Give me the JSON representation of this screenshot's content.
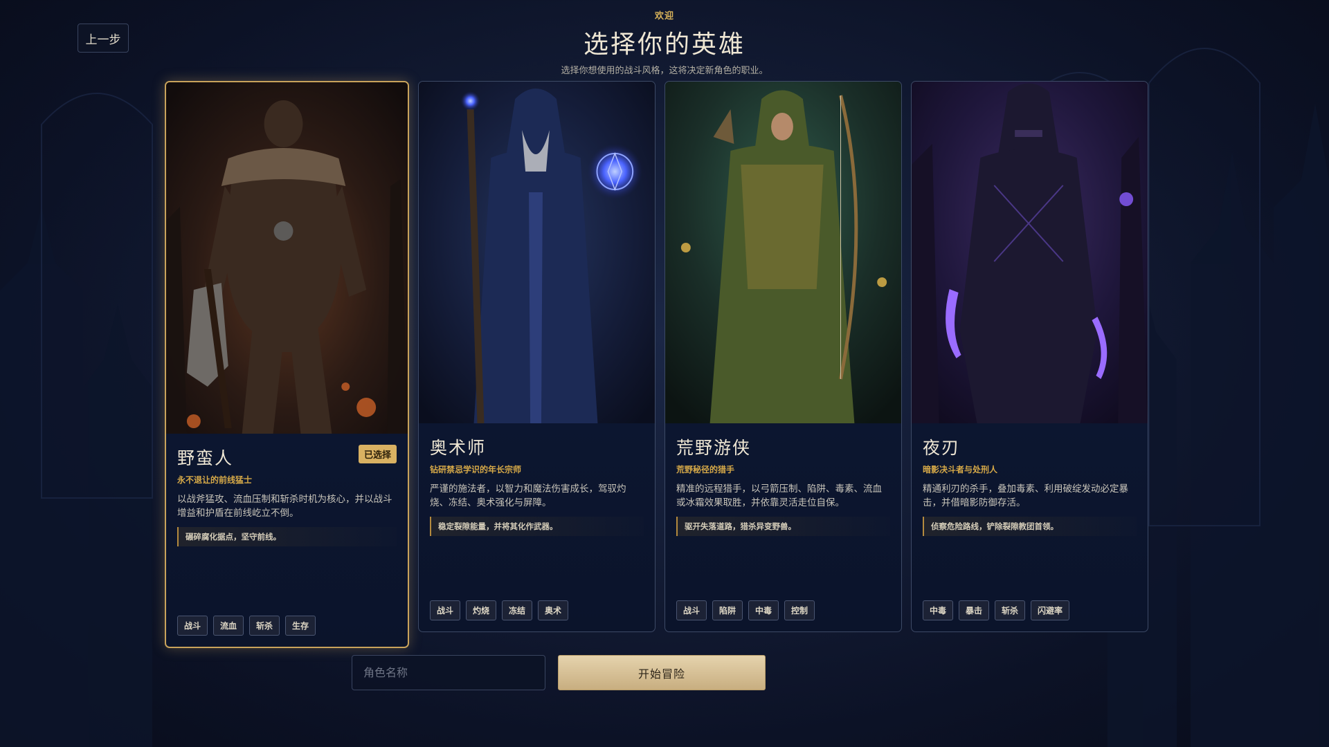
{
  "nav": {
    "back_label": "上一步"
  },
  "header": {
    "welcome": "欢迎",
    "title": "选择你的英雄",
    "subtitle": "选择你想使用的战斗风格，这将决定新角色的职业。"
  },
  "classes": [
    {
      "name": "野蛮人",
      "selected": true,
      "badge": "已选择",
      "tagline": "永不退让的前线猛士",
      "description": "以战斧猛攻、流血压制和斩杀时机为核心，并以战斗增益和护盾在前线屹立不倒。",
      "quote": "碾碎腐化据点，坚守前线。",
      "tags": [
        "战斗",
        "流血",
        "斩杀",
        "生存"
      ],
      "accent": "#c9a35b"
    },
    {
      "name": "奥术师",
      "selected": false,
      "tagline": "钻研禁忌学识的年长宗师",
      "description": "严谨的施法者，以智力和魔法伤害成长，驾驭灼烧、冻结、奥术强化与屏障。",
      "quote": "稳定裂隙能量，并将其化作武器。",
      "tags": [
        "战斗",
        "灼烧",
        "冻结",
        "奥术"
      ],
      "accent": "#3b5cff"
    },
    {
      "name": "荒野游侠",
      "selected": false,
      "tagline": "荒野秘径的猎手",
      "description": "精准的远程猎手，以弓箭压制、陷阱、毒素、流血或冰霜效果取胜，并依靠灵活走位自保。",
      "quote": "驱开失落道路，猎杀异变野兽。",
      "tags": [
        "战斗",
        "陷阱",
        "中毒",
        "控制"
      ],
      "accent": "#3f8a4a"
    },
    {
      "name": "夜刃",
      "selected": false,
      "tagline": "暗影决斗者与处刑人",
      "description": "精通利刃的杀手，叠加毒素、利用破绽发动必定暴击，并借暗影防御存活。",
      "quote": "侦察危险路线，铲除裂隙教团首领。",
      "tags": [
        "中毒",
        "暴击",
        "斩杀",
        "闪避率"
      ],
      "accent": "#8a4cff"
    }
  ],
  "form": {
    "name_placeholder": "角色名称",
    "start_label": "开始冒险"
  }
}
